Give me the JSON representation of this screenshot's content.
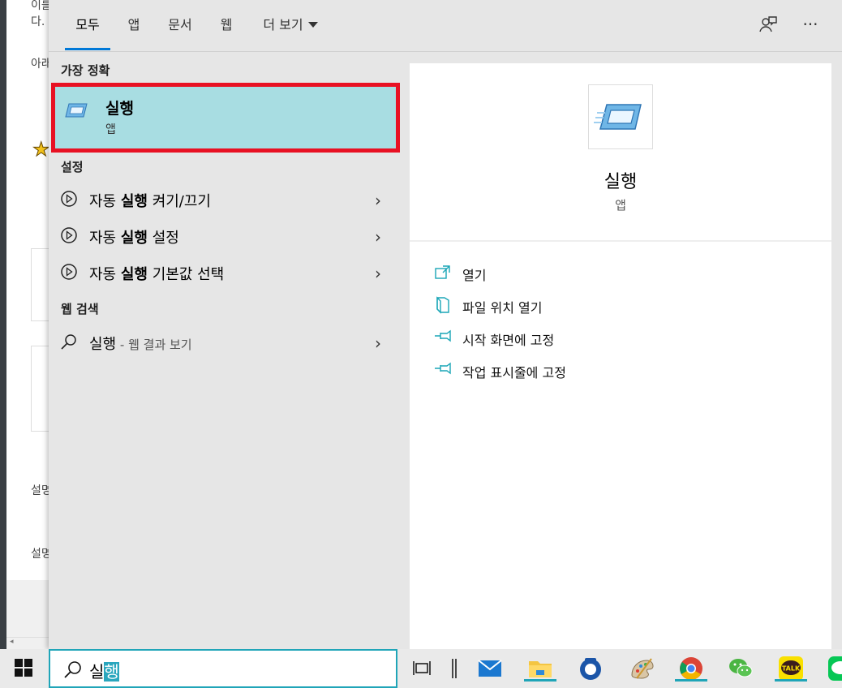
{
  "background": {
    "fragments": [
      "이를",
      "다.",
      "아래",
      "설명",
      "설명"
    ]
  },
  "tabs": [
    {
      "label": "모두",
      "active": true
    },
    {
      "label": "앱",
      "active": false
    },
    {
      "label": "문서",
      "active": false
    },
    {
      "label": "웹",
      "active": false
    },
    {
      "label": "더 보기",
      "active": false,
      "has_dropdown": true
    }
  ],
  "top_icons": [
    "feedback-icon",
    "more-options-icon"
  ],
  "results": {
    "best_match_header": "가장 정확",
    "best_match": {
      "title": "실행",
      "subtitle": "앱",
      "icon": "run-app-icon"
    },
    "settings_header": "설정",
    "settings_items": [
      {
        "prefix": "자동 ",
        "bold": "실행",
        "suffix": " 켜기/끄기"
      },
      {
        "prefix": "자동 ",
        "bold": "실행",
        "suffix": " 설정"
      },
      {
        "prefix": "자동 ",
        "bold": "실행",
        "suffix": " 기본값 선택"
      }
    ],
    "web_header": "웹 검색",
    "web_item": {
      "query": "실행",
      "sub": " - 웹 결과 보기"
    }
  },
  "preview": {
    "title": "실행",
    "subtitle": "앱",
    "actions": [
      {
        "label": "열기",
        "icon": "open-icon"
      },
      {
        "label": "파일 위치 열기",
        "icon": "file-location-icon"
      },
      {
        "label": "시작 화면에 고정",
        "icon": "pin-start-icon"
      },
      {
        "label": "작업 표시줄에 고정",
        "icon": "pin-taskbar-icon"
      }
    ]
  },
  "search": {
    "typed": "실",
    "composing": "행"
  },
  "taskbar": {
    "apps": [
      "task-view-icon",
      "separator-icon",
      "mail-icon",
      "file-explorer-icon",
      "phone-app-icon",
      "paint-icon",
      "chrome-icon",
      "wechat-icon",
      "kakaotalk-icon",
      "line-icon"
    ],
    "kakao_label": "TALK"
  },
  "colors": {
    "accent": "#0078d7",
    "highlight": "#a8dde2",
    "focus_border": "#e81123",
    "teal": "#20a5b8"
  }
}
